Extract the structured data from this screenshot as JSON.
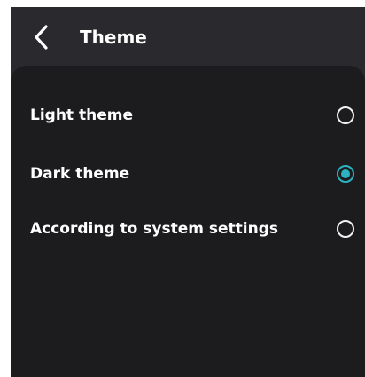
{
  "header": {
    "title": "Theme",
    "back_icon": "chevron-left-icon"
  },
  "options": [
    {
      "label": "Light theme",
      "selected": false
    },
    {
      "label": "Dark theme",
      "selected": true
    },
    {
      "label": "According to system settings",
      "selected": false
    }
  ],
  "colors": {
    "header_bg": "#2a2a2e",
    "sheet_bg": "#1c1c1f",
    "accent": "#2bb3c0",
    "text": "#ffffff"
  }
}
